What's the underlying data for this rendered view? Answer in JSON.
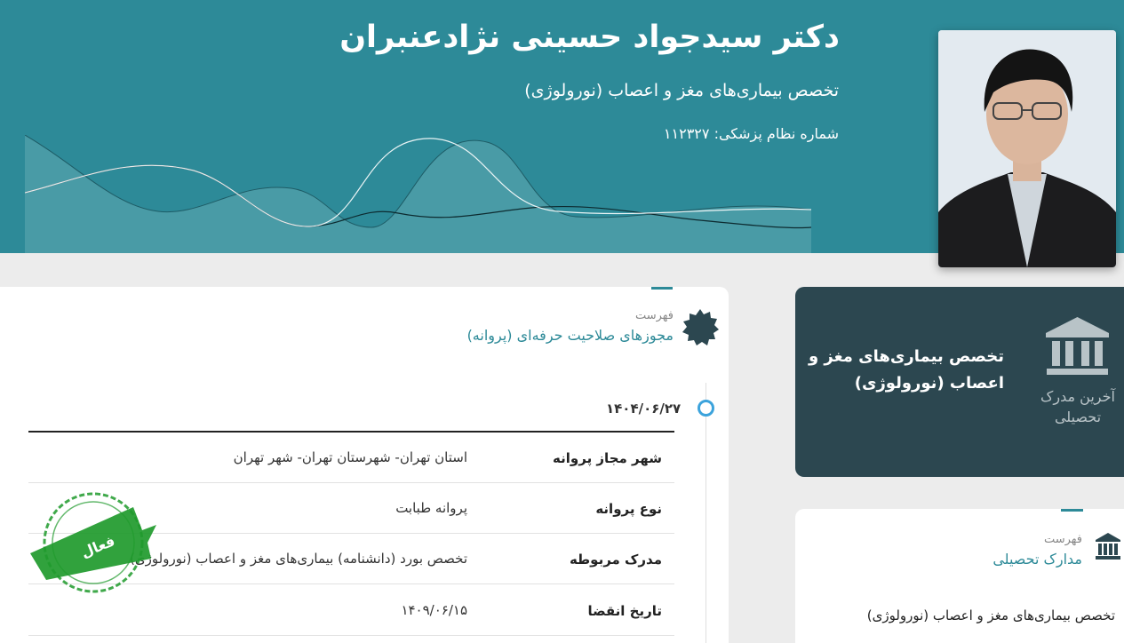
{
  "doctor": {
    "name": "دکتر سیدجواد حسینی نژادعنبران",
    "specialty": "تخصص بیماری‌های مغز و اعصاب (نورولوژی)",
    "license_number": "شماره نظام پزشکی: ۱۱۲۳۲۷"
  },
  "licenses": {
    "label": "فهرست",
    "title": "مجوزهای صلاحیت حرفه‌ای (پروانه)",
    "entry": {
      "date": "۱۴۰۴/۰۶/۲۷",
      "rows": [
        {
          "key": "شهر مجاز پروانه",
          "value": "استان تهران- شهرستان تهران- شهر تهران"
        },
        {
          "key": "نوع پروانه",
          "value": "پروانه طبابت"
        },
        {
          "key": "مدرک مربوطه",
          "value": "تخصص بورد (دانشنامه) بیماری‌های مغز و اعصاب (نورولوژی)"
        },
        {
          "key": "تاریخ انقضا",
          "value": "۱۴۰۹/۰۶/۱۵"
        }
      ],
      "stamp_text": "فعال"
    }
  },
  "latest_degree": {
    "caption": "آخرین مدرک تحصیلی",
    "title": "تخصص بیماری‌های مغز و اعصاب (نورولوژی)"
  },
  "degrees": {
    "label": "فهرست",
    "title": "مدارک تحصیلی",
    "items": [
      "تخصص بیماری‌های مغز و اعصاب (نورولوژی)"
    ]
  },
  "colors": {
    "header": "#2d8a98",
    "accent": "#2d8a98",
    "dark_card": "#2c4750",
    "timeline_dot": "#3ca3dc",
    "stamp": "#1f9a2c"
  },
  "icons": {
    "license_badge": "seal-badge-icon",
    "degree": "museum-icon"
  }
}
